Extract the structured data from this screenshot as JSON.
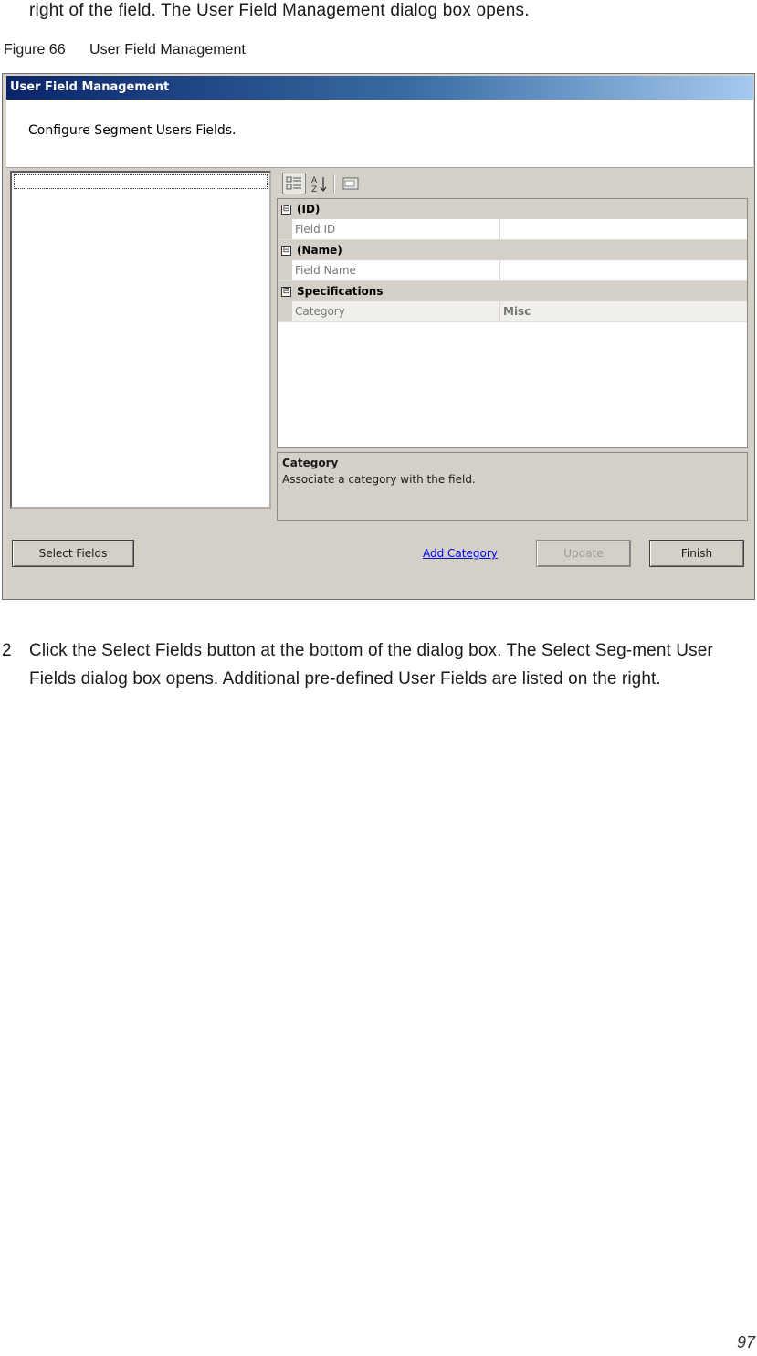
{
  "intro_text": "right of the field. The User Field Management dialog box opens.",
  "figure": {
    "number": "Figure 66",
    "title": "User Field Management"
  },
  "dialog": {
    "title": "User Field Management",
    "header_text": "Configure Segment Users Fields.",
    "toolbar": {
      "icons": [
        "categorized-icon",
        "alphabetical-sort-icon",
        "property-pages-icon"
      ]
    },
    "categories": [
      {
        "toggle": "⊟",
        "label": "(ID)",
        "properties": [
          {
            "name": "Field ID",
            "value": ""
          }
        ]
      },
      {
        "toggle": "⊟",
        "label": "(Name)",
        "properties": [
          {
            "name": "Field Name",
            "value": ""
          }
        ]
      },
      {
        "toggle": "⊟",
        "label": "Specifications",
        "properties": [
          {
            "name": "Category",
            "value": "Misc"
          }
        ]
      }
    ],
    "description": {
      "title": "Category",
      "text": "Associate a category with the field."
    },
    "buttons": {
      "select_fields": "Select Fields",
      "add_category": "Add Category",
      "update": "Update",
      "finish": "Finish"
    }
  },
  "step": {
    "number": "2",
    "text": "Click the Select Fields button at the bottom of the dialog box. The Select Seg-ment User Fields dialog box opens. Additional pre-defined User Fields are listed on the right."
  },
  "page_number": "97"
}
